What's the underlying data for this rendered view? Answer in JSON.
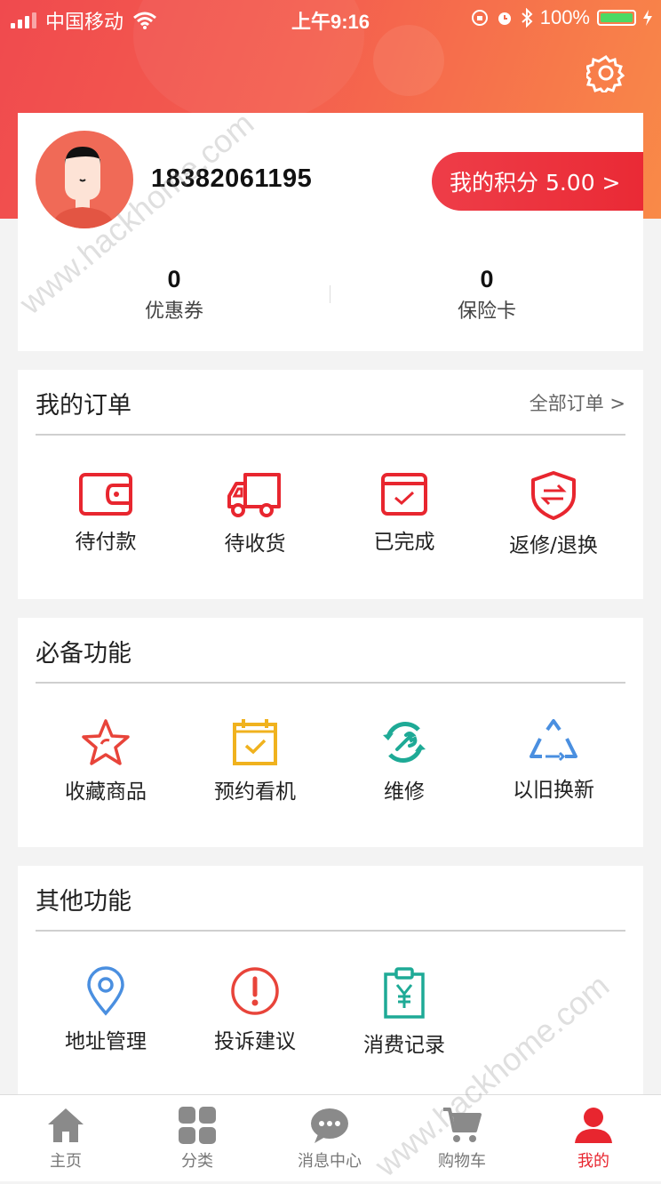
{
  "status_bar": {
    "carrier": "中国移动",
    "time": "上午9:16",
    "battery": "100%"
  },
  "colors": {
    "brand_red": "#e8262f",
    "hero_start": "#f04a4e",
    "hero_end": "#f98a48",
    "green_icon": "#1eaa96",
    "blue_icon": "#4a8fe0",
    "yellow_icon": "#f0b21e"
  },
  "profile": {
    "phone": "18382061195",
    "points_label": "我的积分 5.00 >",
    "stats": [
      {
        "value": "0",
        "label": "优惠券"
      },
      {
        "value": "0",
        "label": "保险卡"
      }
    ]
  },
  "orders": {
    "title": "我的订单",
    "more": "全部订单 >",
    "items": [
      {
        "label": "待付款",
        "icon": "wallet-icon"
      },
      {
        "label": "待收货",
        "icon": "truck-icon"
      },
      {
        "label": "已完成",
        "icon": "calendar-check-icon"
      },
      {
        "label": "返修/退换",
        "icon": "shield-exchange-icon"
      }
    ]
  },
  "essential": {
    "title": "必备功能",
    "items": [
      {
        "label": "收藏商品",
        "icon": "star-icon"
      },
      {
        "label": "预约看机",
        "icon": "calendar-check-icon"
      },
      {
        "label": "维修",
        "icon": "wrench-refresh-icon"
      },
      {
        "label": "以旧换新",
        "icon": "recycle-icon"
      }
    ]
  },
  "other": {
    "title": "其他功能",
    "items": [
      {
        "label": "地址管理",
        "icon": "location-pin-icon"
      },
      {
        "label": "投诉建议",
        "icon": "exclamation-circle-icon"
      },
      {
        "label": "消费记录",
        "icon": "yen-clipboard-icon"
      }
    ]
  },
  "tabbar": {
    "active": "我的",
    "items": [
      {
        "label": "主页",
        "icon": "home-icon"
      },
      {
        "label": "分类",
        "icon": "grid-icon"
      },
      {
        "label": "消息中心",
        "icon": "chat-icon"
      },
      {
        "label": "购物车",
        "icon": "cart-icon"
      },
      {
        "label": "我的",
        "icon": "person-icon"
      }
    ]
  },
  "watermark": "www.hackhome.com"
}
